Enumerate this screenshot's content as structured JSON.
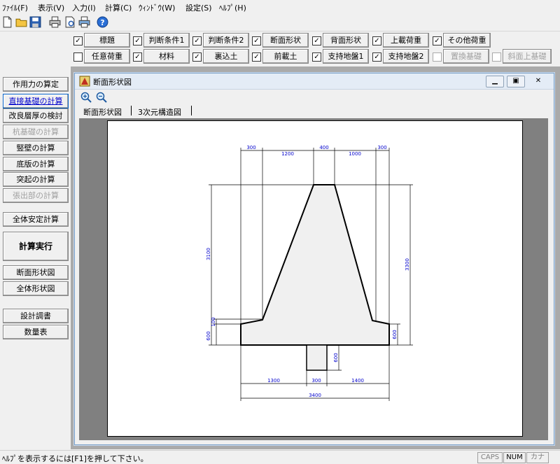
{
  "menu": [
    "ﾌｧｲﾙ(F)",
    "表示(V)",
    "入力(I)",
    "計算(C)",
    "ｳｨﾝﾄﾞｳ(W)",
    "設定(S)",
    "ﾍﾙﾌﾟ(H)"
  ],
  "row1": [
    {
      "label": "標題",
      "checked": true
    },
    {
      "label": "判断条件1",
      "checked": true
    },
    {
      "label": "判断条件2",
      "checked": true
    },
    {
      "label": "断面形状",
      "checked": true
    },
    {
      "label": "背面形状",
      "checked": true
    },
    {
      "label": "上載荷重",
      "checked": true
    },
    {
      "label": "その他荷重",
      "checked": true
    }
  ],
  "row2": [
    {
      "label": "任意荷重",
      "checked": false
    },
    {
      "label": "材料",
      "checked": true
    },
    {
      "label": "裏込土",
      "checked": true
    },
    {
      "label": "前載土",
      "checked": true
    },
    {
      "label": "支持地盤1",
      "checked": true
    },
    {
      "label": "支持地盤2",
      "checked": true
    },
    {
      "label": "置換基礎",
      "checked": false
    },
    {
      "label": "斜面上基礎",
      "checked": false
    }
  ],
  "left": {
    "b1": "作用力の算定",
    "b2": "直接基礎の計算",
    "b3": "改良層厚の検討",
    "b4": "杭基礎の計算",
    "b5": "竪壁の計算",
    "b6": "底版の計算",
    "b7": "突起の計算",
    "b8": "張出部の計算",
    "b9": "全体安定計算",
    "b10": "計算実行",
    "b11": "断面形状図",
    "b12": "全体形状図",
    "b13": "設計調書",
    "b14": "数量表"
  },
  "child": {
    "title": "断面形状図",
    "tab1": "断面形状図",
    "tab2": "3次元構造図"
  },
  "dims": {
    "d300a": "300",
    "d1200": "1200",
    "d400": "400",
    "d1000": "1000",
    "d300b": "300",
    "d3100": "3100",
    "d3300": "3300",
    "d100": "100",
    "d600l": "600",
    "d600r": "600",
    "d600k": "600",
    "d1300": "1300",
    "d300c": "300",
    "d1400": "1400",
    "d3400": "3400"
  },
  "status": {
    "message": "ﾍﾙﾌﾟを表示するには[F1]を押して下さい。",
    "caps": "CAPS",
    "num": "NUM",
    "kana": "カナ"
  },
  "colors": {
    "dimension_text": "#0000cc",
    "section_fill": "#f0f0f0",
    "mdi_bg": "#aaaaaa"
  }
}
